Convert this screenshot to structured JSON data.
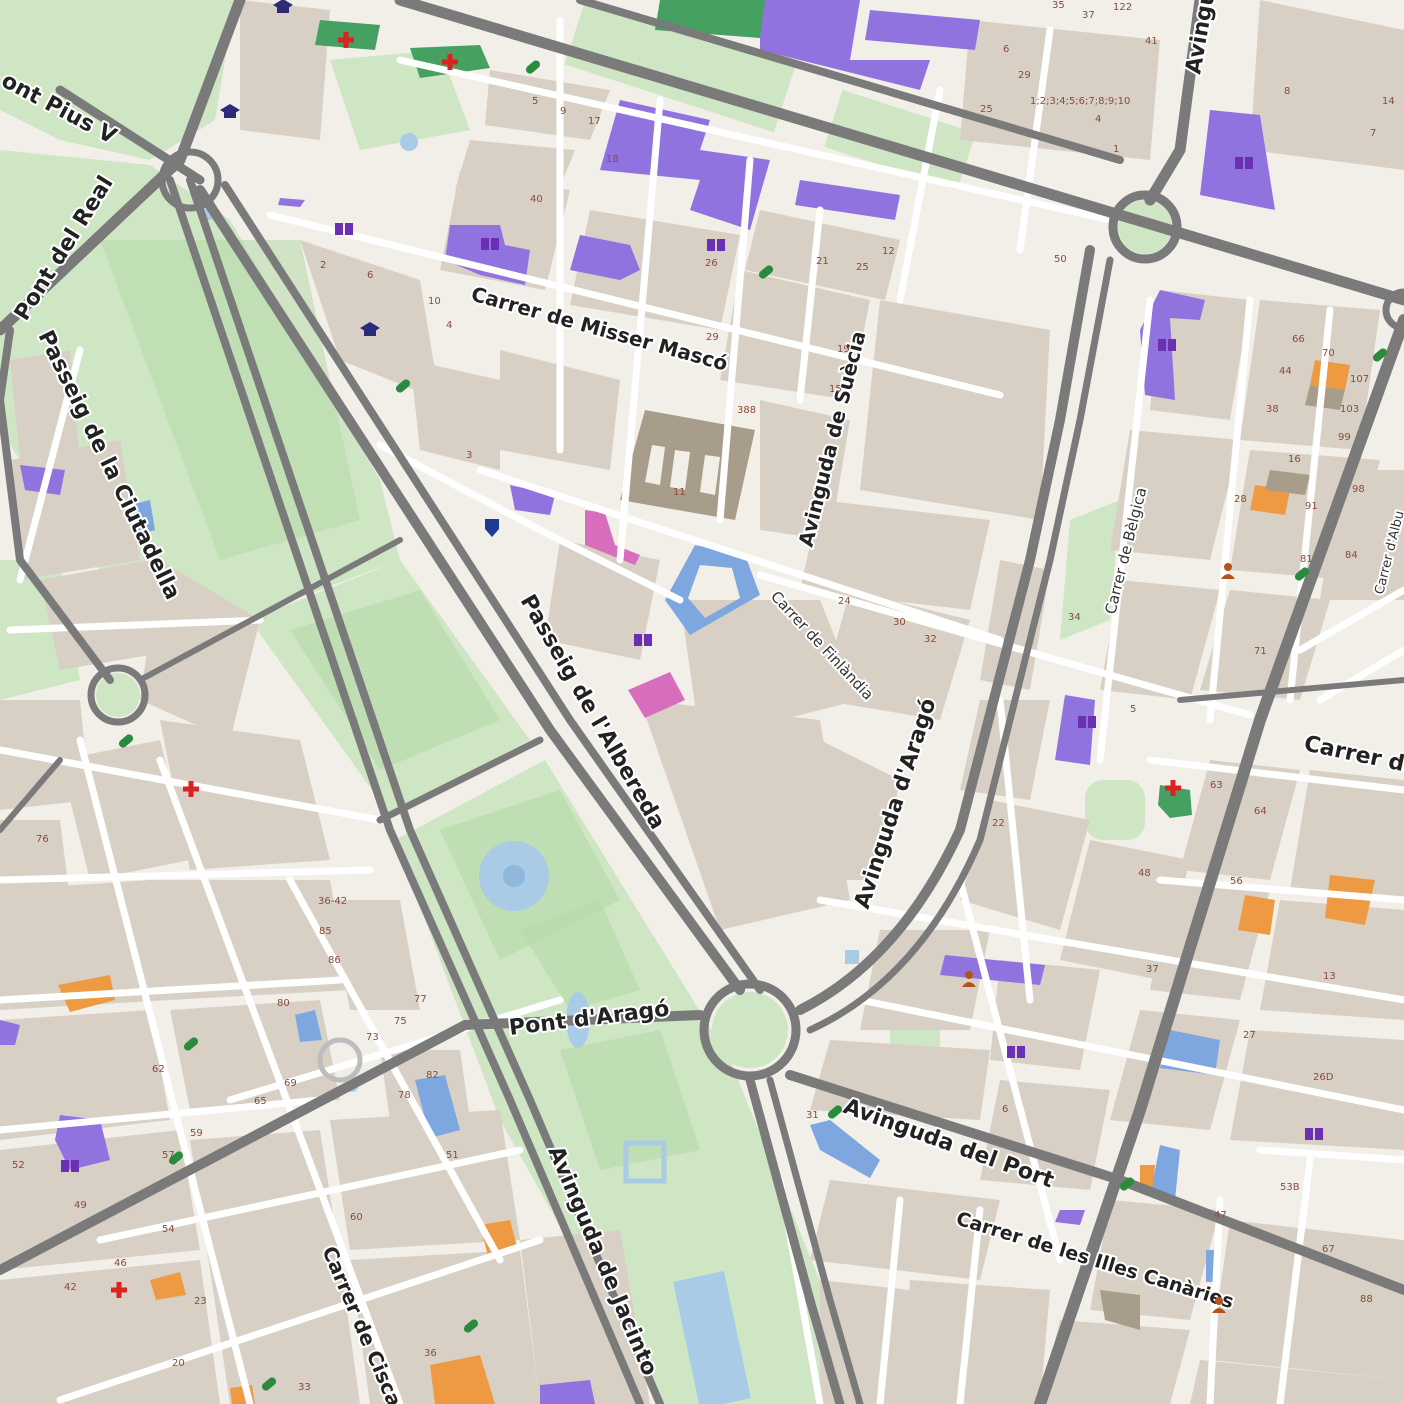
{
  "map": {
    "colors": {
      "background": "#f2efe9",
      "park": "#cfe6c5",
      "park_dark": "#b6d9a7",
      "building": "#d9d0c5",
      "road": "#ffffff",
      "major_road": "#7a7a7a",
      "road_casing": "#bdbdbd",
      "water": "#a9cbe6",
      "education": "#9173e0",
      "hospital": "#45a061",
      "sports": "#7ea7e0",
      "commercial": "#ee9a42",
      "religious": "#d96dbd",
      "stadium": "#a79d8a"
    },
    "streets": [
      {
        "id": "pius-v",
        "name": "ont Pius V"
      },
      {
        "id": "pont-real",
        "name": "Pont del Real"
      },
      {
        "id": "ciutadella",
        "name": "Passeig de la Ciutadella"
      },
      {
        "id": "misser-masco",
        "name": "Carrer de Misser Mascó"
      },
      {
        "id": "suecia",
        "name": "Avinguda de Suècia"
      },
      {
        "id": "albereda",
        "name": "Passeig de l'Albereda"
      },
      {
        "id": "finlandia",
        "name": "Carrer de Finlàndia"
      },
      {
        "id": "arago",
        "name": "Avinguda d'Aragó"
      },
      {
        "id": "belgica",
        "name": "Carrer de Bèlgica"
      },
      {
        "id": "carrer-de",
        "name": "Carrer de"
      },
      {
        "id": "pont-arago",
        "name": "Pont d'Aragó"
      },
      {
        "id": "port",
        "name": "Avinguda del Port"
      },
      {
        "id": "illes-canaries",
        "name": "Carrer de les Illes Canàries"
      },
      {
        "id": "jacinto",
        "name": "Avinguda de Jacinto"
      },
      {
        "id": "cisca",
        "name": "Carrer de Cisca"
      },
      {
        "id": "avinguda-top",
        "name": "Avinguda"
      },
      {
        "id": "albu",
        "name": "Carrer d'Albu"
      }
    ],
    "house_numbers": [
      "35",
      "37",
      "122",
      "41",
      "6",
      "29",
      "25",
      "1;2;3;4;5;6;7;8;9;10",
      "8",
      "14",
      "7",
      "1",
      "4",
      "5",
      "9",
      "17",
      "18",
      "40",
      "26",
      "12",
      "21",
      "25",
      "50",
      "10",
      "2",
      "6",
      "4",
      "29",
      "19",
      "15",
      "388",
      "11",
      "3",
      "66",
      "70",
      "107",
      "103",
      "99",
      "44",
      "38",
      "16",
      "28",
      "91",
      "98",
      "84",
      "81",
      "24",
      "30",
      "32",
      "34",
      "71",
      "22",
      "63",
      "64",
      "5",
      "56",
      "48",
      "37",
      "13",
      "27",
      "26D",
      "53B",
      "47",
      "67",
      "88",
      "31",
      "52",
      "46",
      "80",
      "76",
      "85",
      "36-42",
      "86",
      "77",
      "75",
      "73",
      "69",
      "65",
      "62",
      "59",
      "57",
      "54",
      "49",
      "42",
      "20",
      "33",
      "36",
      "23",
      "60",
      "51",
      "78",
      "82",
      "6"
    ],
    "poi_icons": [
      "hospital-icon",
      "school-icon",
      "library-icon",
      "pharmacy-icon",
      "police-icon",
      "social-facility-icon"
    ]
  }
}
